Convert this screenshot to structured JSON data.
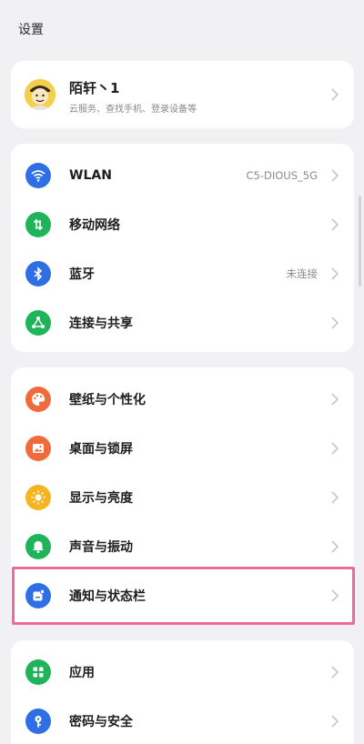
{
  "page": {
    "title": "设置"
  },
  "profile": {
    "name": "陌轩丶1",
    "subtitle": "云服务、查找手机、登录设备等"
  },
  "groups": [
    {
      "items": [
        {
          "label": "WLAN",
          "value": "C5-DIOUS_5G",
          "icon": "wifi-icon",
          "color": "#2f6fe6"
        },
        {
          "label": "移动网络",
          "value": "",
          "icon": "mobile-data-icon",
          "color": "#1fb45a"
        },
        {
          "label": "蓝牙",
          "value": "未连接",
          "icon": "bluetooth-icon",
          "color": "#2f6fe6"
        },
        {
          "label": "连接与共享",
          "value": "",
          "icon": "connection-sharing-icon",
          "color": "#1fb45a"
        }
      ]
    },
    {
      "items": [
        {
          "label": "壁纸与个性化",
          "value": "",
          "icon": "palette-icon",
          "color": "#ef6b3c"
        },
        {
          "label": "桌面与锁屏",
          "value": "",
          "icon": "picture-icon",
          "color": "#ef6b3c"
        },
        {
          "label": "显示与亮度",
          "value": "",
          "icon": "sun-icon",
          "color": "#f5b521"
        },
        {
          "label": "声音与振动",
          "value": "",
          "icon": "bell-icon",
          "color": "#1fb45a"
        },
        {
          "label": "通知与状态栏",
          "value": "",
          "icon": "notification-icon",
          "color": "#2f6fe6"
        }
      ]
    },
    {
      "items": [
        {
          "label": "应用",
          "value": "",
          "icon": "apps-grid-icon",
          "color": "#1fb45a"
        },
        {
          "label": "密码与安全",
          "value": "",
          "icon": "key-icon",
          "color": "#2f6fe6"
        }
      ]
    }
  ]
}
